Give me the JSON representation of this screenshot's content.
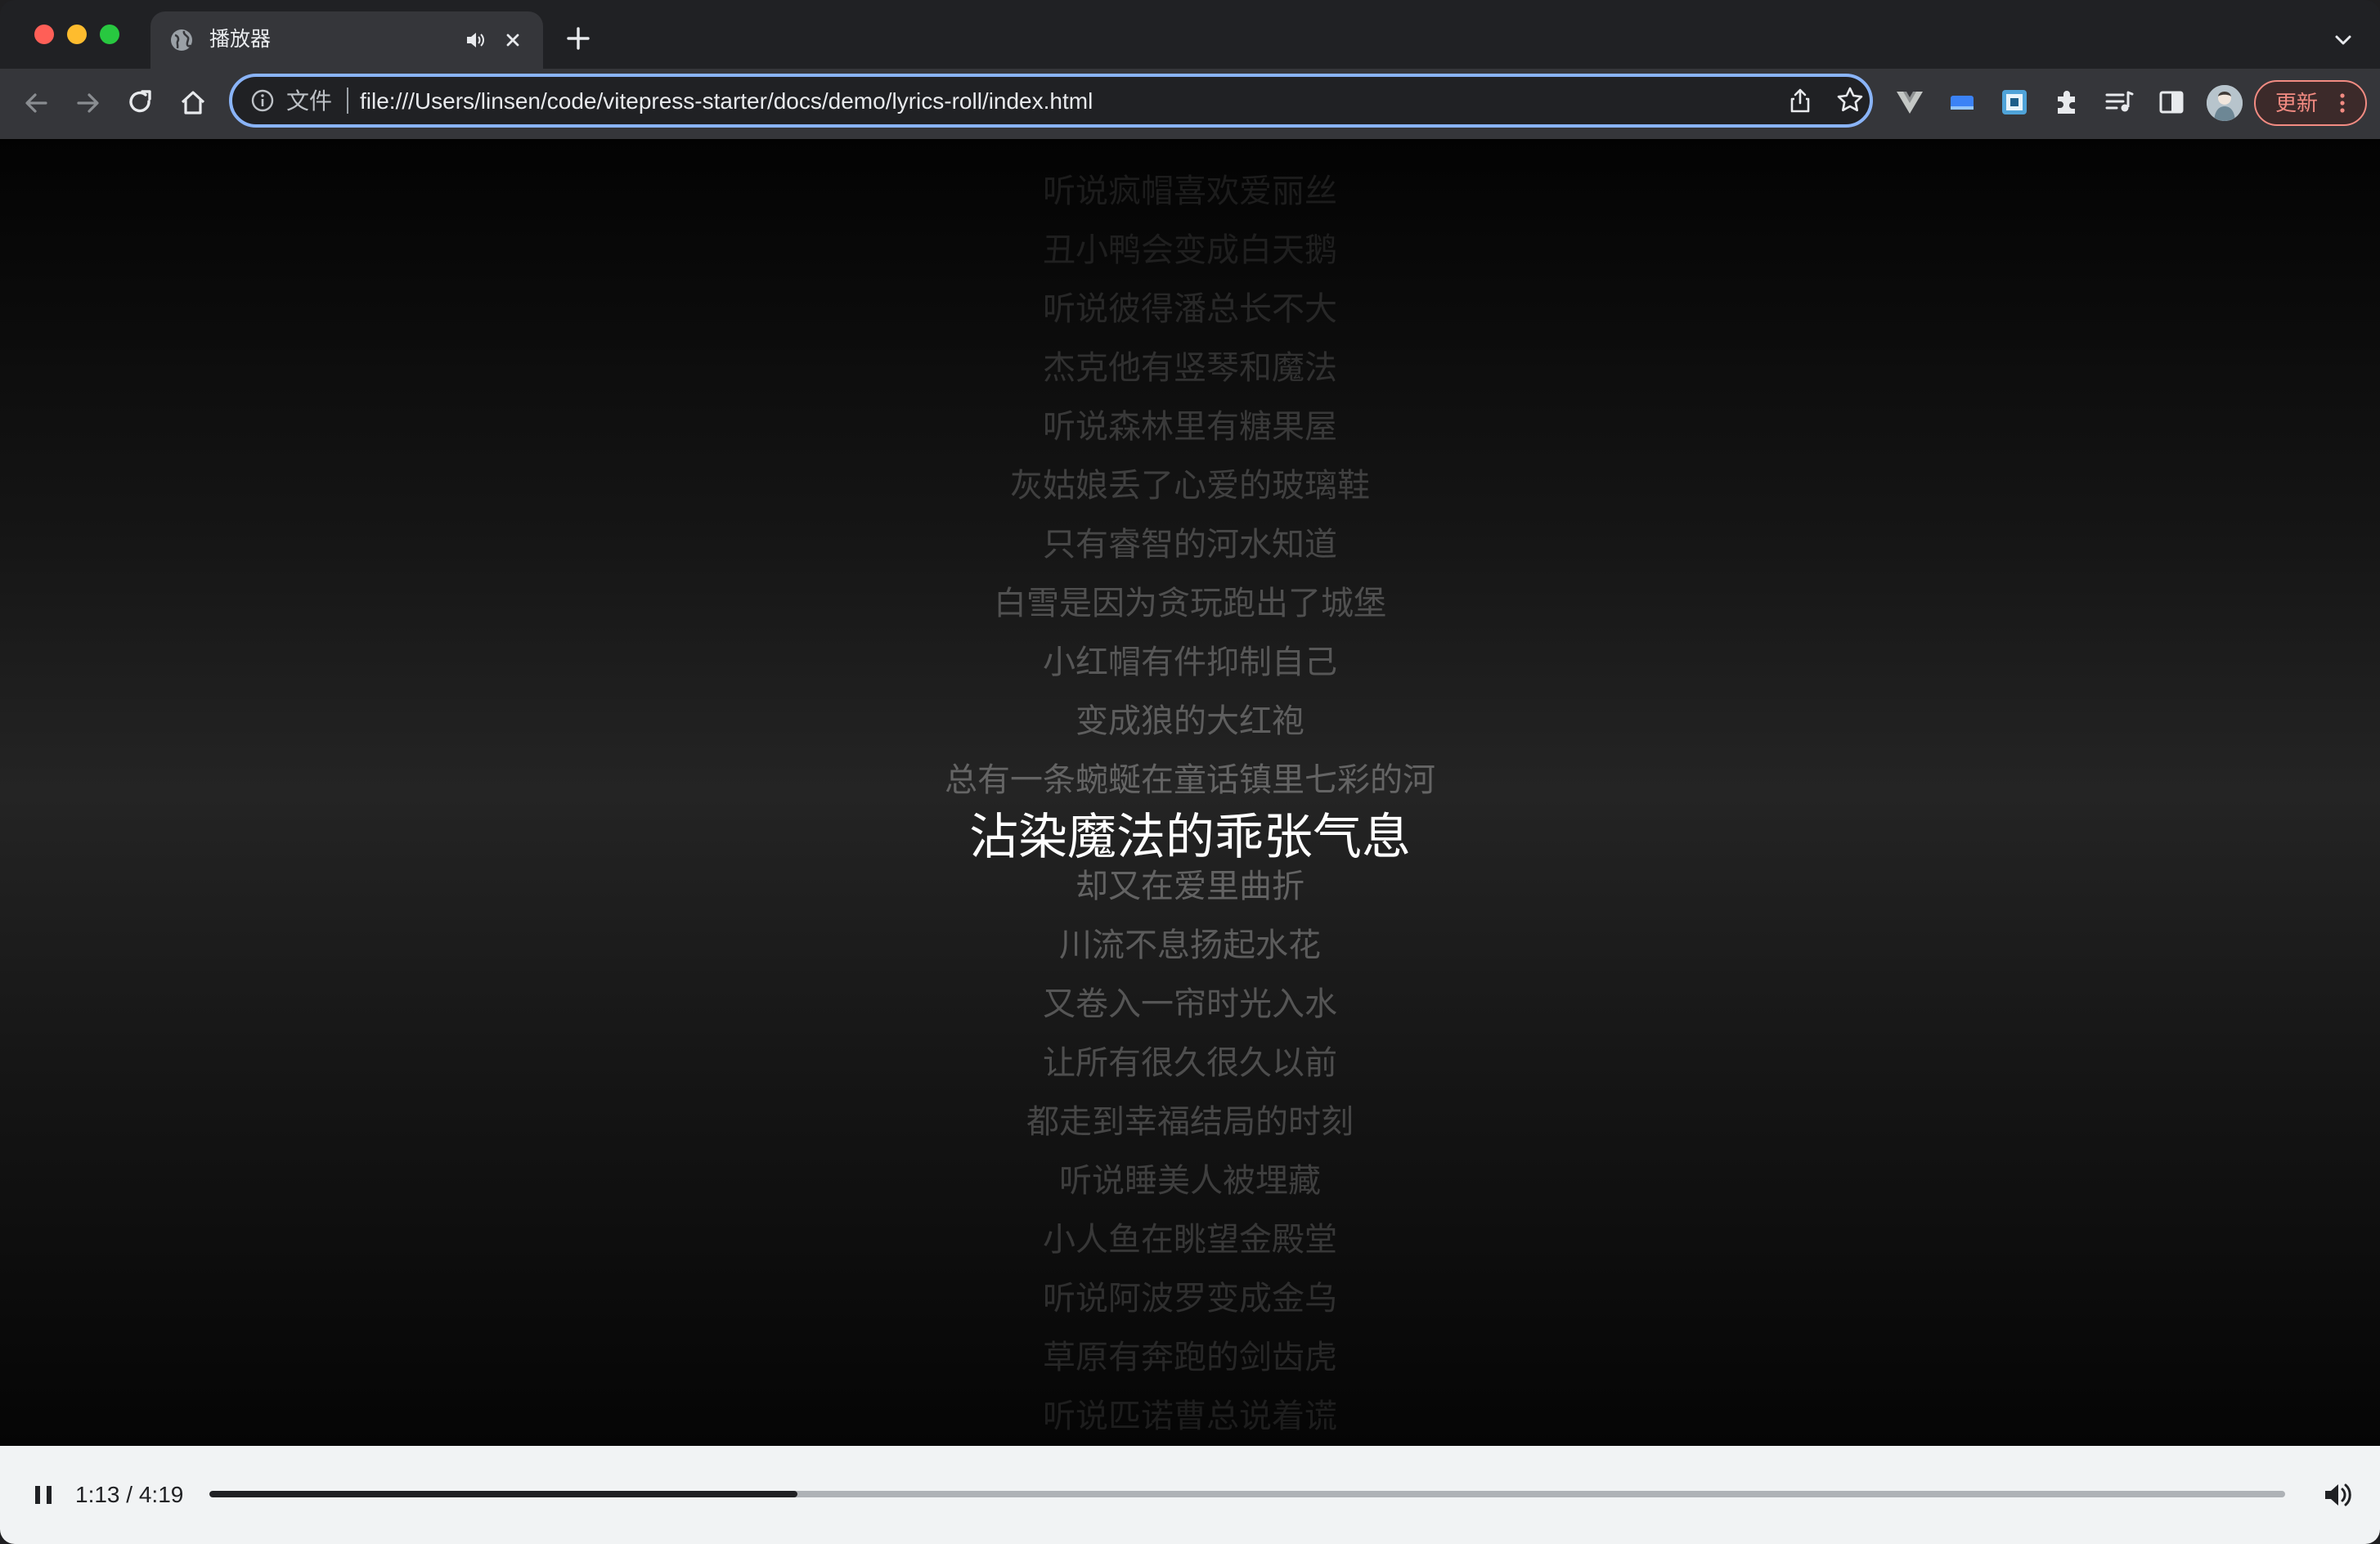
{
  "browser": {
    "tab": {
      "title": "播放器"
    },
    "omnibox": {
      "scheme_label": "文件",
      "url": "file:///Users/linsen/code/vitepress-starter/docs/demo/lyrics-roll/index.html"
    },
    "update_label": "更新",
    "accent_color": "#8ab4f8"
  },
  "lyrics": {
    "lines": [
      "听说疯帽喜欢爱丽丝",
      "丑小鸭会变成白天鹅",
      "听说彼得潘总长不大",
      "杰克他有竖琴和魔法",
      "听说森林里有糖果屋",
      "灰姑娘丢了心爱的玻璃鞋",
      "只有睿智的河水知道",
      "白雪是因为贪玩跑出了城堡",
      "小红帽有件抑制自己",
      "变成狼的大红袍",
      "总有一条蜿蜒在童话镇里七彩的河",
      "沾染魔法的乖张气息",
      "却又在爱里曲折",
      "川流不息扬起水花",
      "又卷入一帘时光入水",
      "让所有很久很久以前",
      "都走到幸福结局的时刻",
      "听说睡美人被埋藏",
      "小人鱼在眺望金殿堂",
      "听说阿波罗变成金乌",
      "草原有奔跑的剑齿虎",
      "听说匹诺曹总说着谎"
    ],
    "active_index": 11,
    "active_color": "#ffffff"
  },
  "player": {
    "current_time": "1:13",
    "separator": "/",
    "duration": "4:19",
    "progress": 0.2834,
    "state": "playing"
  }
}
